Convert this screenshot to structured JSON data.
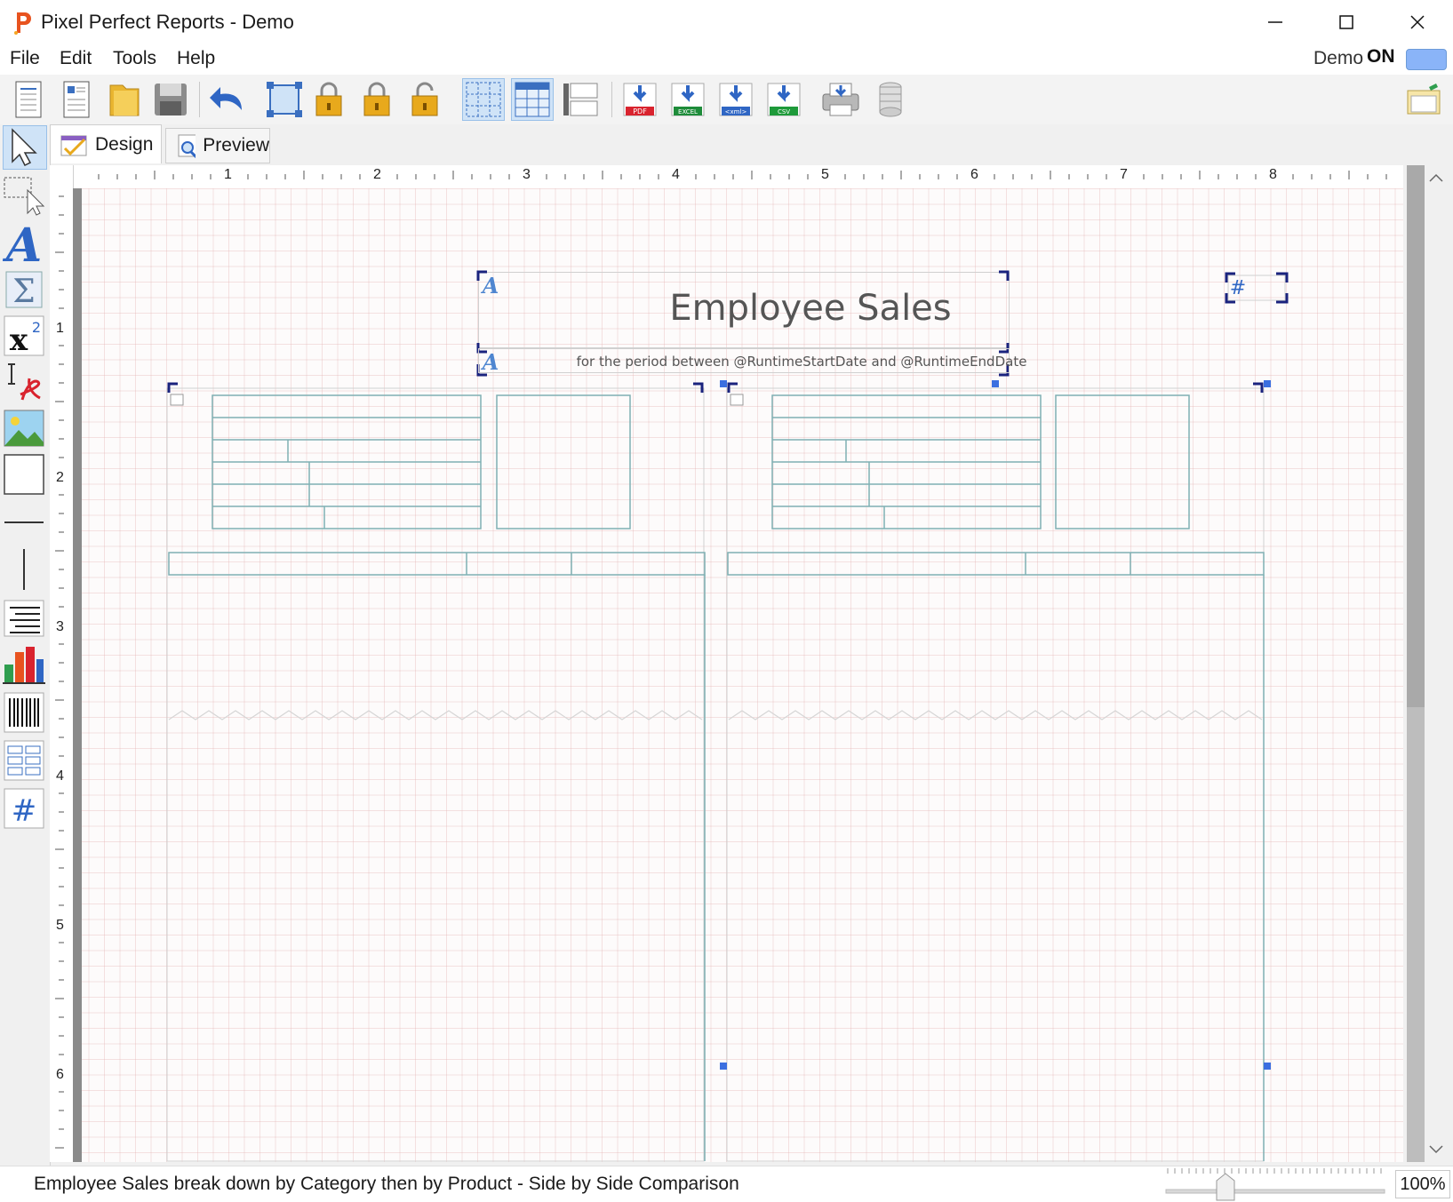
{
  "window": {
    "title": "Pixel Perfect Reports - Demo",
    "brand_color": "#e8531f"
  },
  "menu": [
    {
      "label": "File"
    },
    {
      "label": "Edit"
    },
    {
      "label": "Tools"
    },
    {
      "label": "Help"
    }
  ],
  "demo_toggle": {
    "label": "Demo",
    "state": "ON"
  },
  "toolbar": {
    "export_labels": {
      "pdf": "PDF",
      "excel": "EXCEL",
      "xml": "<xml>",
      "csv": "CSV"
    }
  },
  "tabs": [
    {
      "label": "Design",
      "active": true
    },
    {
      "label": "Preview",
      "active": false
    }
  ],
  "ruler": {
    "horizontal": [
      "1",
      "2",
      "3",
      "4",
      "5",
      "6",
      "7",
      "8"
    ],
    "vertical": [
      "1",
      "2",
      "3",
      "4",
      "5",
      "6"
    ]
  },
  "report": {
    "title": "Employee Sales",
    "subtitle": "for the period between @RuntimeStartDate and @RuntimeEndDate",
    "page_number_symbol": "#"
  },
  "status": {
    "description": "Employee Sales break down by Category then by Product - Side by Side Comparison",
    "zoom": "100%"
  },
  "colors": {
    "table_lines": "#7fb0b3",
    "selection_handle": "#3b6fe0",
    "bracket": "#1a237e"
  }
}
